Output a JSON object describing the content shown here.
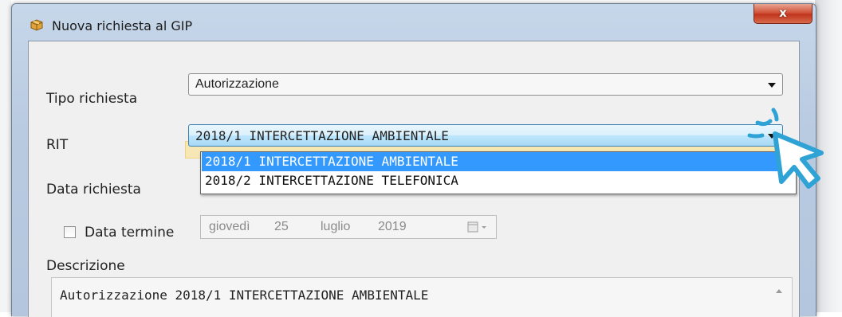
{
  "window": {
    "title": "Nuova richiesta al GIP",
    "close_glyph": "x",
    "icon": "package-icon"
  },
  "form": {
    "tipo_richiesta": {
      "label": "Tipo richiesta",
      "value": "Autorizzazione"
    },
    "rit": {
      "label": "RIT",
      "value": "2018/1 INTERCETTAZIONE AMBIENTALE",
      "options": [
        "2018/1 INTERCETTAZIONE AMBIENTALE",
        "2018/2 INTERCETTAZIONE TELEFONICA"
      ],
      "selected_index": 0
    },
    "data_richiesta": {
      "label": "Data richiesta"
    },
    "data_termine": {
      "label": "Data termine",
      "checked": false,
      "weekday": "giovedì",
      "day": "25",
      "month": "luglio",
      "year": "2019"
    },
    "descrizione": {
      "label": "Descrizione",
      "value": "Autorizzazione 2018/1 INTERCETTAZIONE AMBIENTALE"
    }
  },
  "colors": {
    "selection": "#3399ff",
    "cursor_accent": "#2fa3d6",
    "close_button": "#c0341c"
  }
}
